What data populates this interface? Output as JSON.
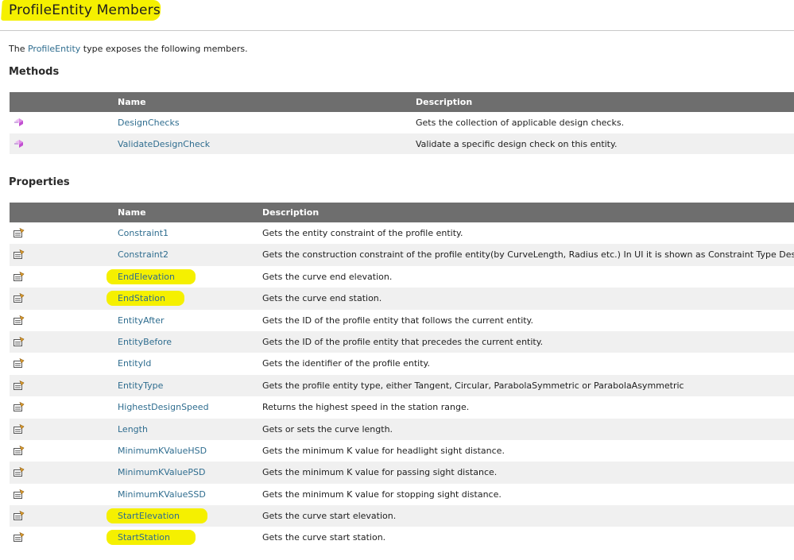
{
  "page": {
    "title": "ProfileEntity Members",
    "intro_prefix": "The ",
    "intro_link": "ProfileEntity",
    "intro_suffix": " type exposes the following members."
  },
  "methods": {
    "heading": "Methods",
    "col_name": "Name",
    "col_description": "Description",
    "rows": [
      {
        "name": "DesignChecks",
        "description": "Gets the collection of applicable design checks.",
        "icon": "method-icon"
      },
      {
        "name": "ValidateDesignCheck",
        "description": "Validate a specific design check on this entity.",
        "icon": "method-icon"
      }
    ]
  },
  "properties": {
    "heading": "Properties",
    "col_name": "Name",
    "col_description": "Description",
    "rows": [
      {
        "name": "Constraint1",
        "description": "Gets the entity constraint of the profile entity.",
        "highlighted": false
      },
      {
        "name": "Constraint2",
        "description": "Gets the construction constraint of the profile entity(by CurveLength, Radius etc.) In UI it is shown as Constraint Type Desc.",
        "highlighted": false
      },
      {
        "name": "EndElevation",
        "description": "Gets the curve end elevation.",
        "highlighted": true
      },
      {
        "name": "EndStation",
        "description": "Gets the curve end station.",
        "highlighted": true
      },
      {
        "name": "EntityAfter",
        "description": "Gets the ID of the profile entity that follows the current entity.",
        "highlighted": false
      },
      {
        "name": "EntityBefore",
        "description": "Gets the ID of the profile entity that precedes the current entity.",
        "highlighted": false
      },
      {
        "name": "EntityId",
        "description": "Gets the identifier of the profile entity.",
        "highlighted": false
      },
      {
        "name": "EntityType",
        "description": "Gets the profile entity type, either Tangent, Circular, ParabolaSymmetric or ParabolaAsymmetric",
        "highlighted": false
      },
      {
        "name": "HighestDesignSpeed",
        "description": "Returns the highest speed in the station range.",
        "highlighted": false
      },
      {
        "name": "Length",
        "description": "Gets or sets the curve length.",
        "highlighted": false
      },
      {
        "name": "MinimumKValueHSD",
        "description": "Gets the minimum K value for headlight sight distance.",
        "highlighted": false
      },
      {
        "name": "MinimumKValuePSD",
        "description": "Gets the minimum K value for passing sight distance.",
        "highlighted": false
      },
      {
        "name": "MinimumKValueSSD",
        "description": "Gets the minimum K value for stopping sight distance.",
        "highlighted": false
      },
      {
        "name": "StartElevation",
        "description": "Gets the curve start elevation.",
        "highlighted": true
      },
      {
        "name": "StartStation",
        "description": "Gets the curve start station.",
        "highlighted": true
      }
    ]
  },
  "colors": {
    "link": "#2f6d8f",
    "header_bg": "#6e6e6e",
    "alt_row": "#f0f0f0",
    "highlight": "#f5f000"
  }
}
